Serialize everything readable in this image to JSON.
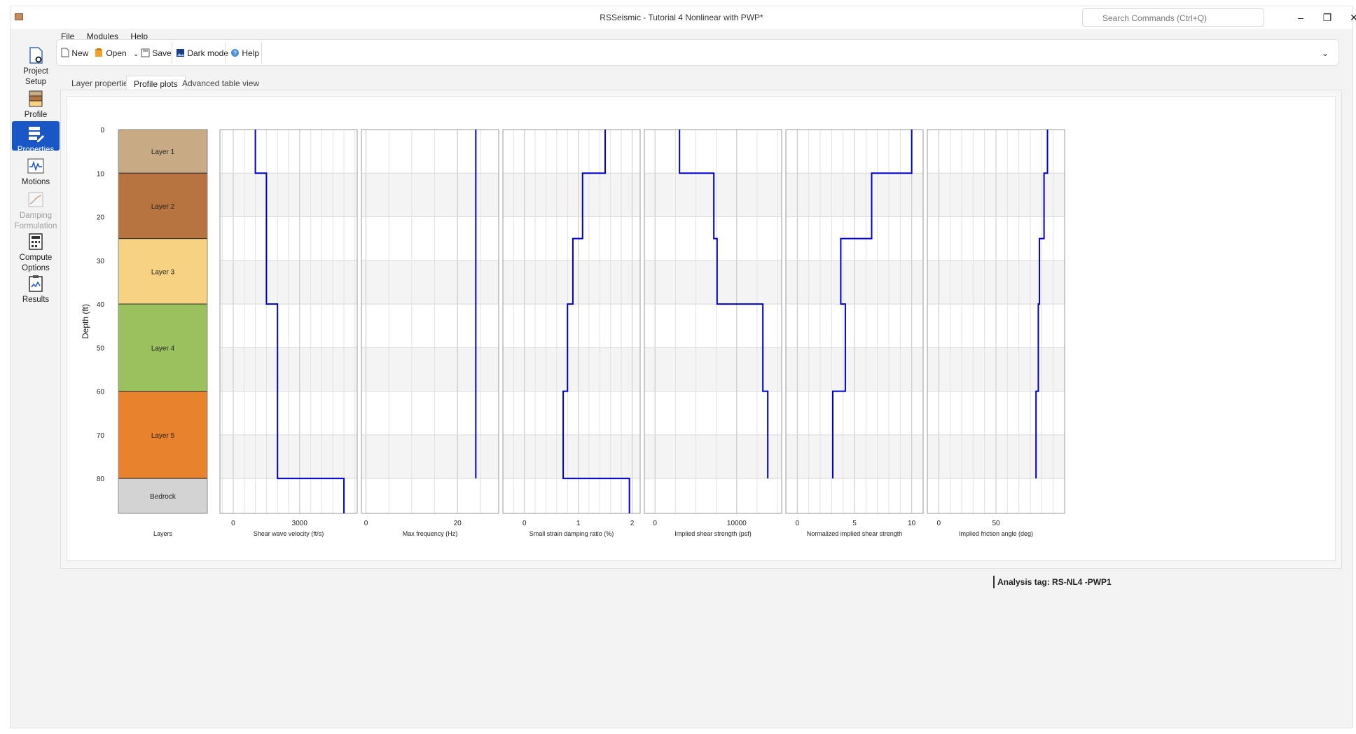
{
  "window": {
    "title": "RSSeismic - Tutorial 4 Nonlinear with PWP*",
    "search_placeholder": "Search Commands (Ctrl+Q)",
    "minimize": "–",
    "maximize": "❐",
    "close": "✕"
  },
  "menu": [
    "File",
    "Modules",
    "Help"
  ],
  "toolbar": {
    "new_label": "New",
    "open_label": "Open",
    "save_label": "Save",
    "dark_label": "Dark mode",
    "help_label": "Help"
  },
  "sidebar": {
    "items": [
      {
        "label_1": "Project",
        "label_2": "Setup"
      },
      {
        "label_1": "Profile",
        "label_2": ""
      },
      {
        "label_1": "Properties",
        "label_2": ""
      },
      {
        "label_1": "Motions",
        "label_2": ""
      },
      {
        "label_1": "Damping",
        "label_2": "Formulation"
      },
      {
        "label_1": "Compute",
        "label_2": "Options"
      },
      {
        "label_1": "Results",
        "label_2": ""
      }
    ]
  },
  "tabs": [
    "Layer properties",
    "Profile plots",
    "Advanced table view"
  ],
  "status": {
    "analysis_tag": "Analysis tag: RS-NL4 -PWP1"
  },
  "chart_data": {
    "type": "line",
    "ylabel": "Depth (ft)",
    "ylim": [
      0,
      88
    ],
    "yticks": [
      0,
      10,
      20,
      30,
      40,
      50,
      60,
      70,
      80
    ],
    "layers": {
      "xlabel": "Layers",
      "items": [
        {
          "name": "Layer 1",
          "top": 0,
          "bottom": 10,
          "color": "#c8aa84"
        },
        {
          "name": "Layer 2",
          "top": 10,
          "bottom": 25,
          "color": "#b87440"
        },
        {
          "name": "Layer 3",
          "top": 25,
          "bottom": 40,
          "color": "#f6d282"
        },
        {
          "name": "Layer 4",
          "top": 40,
          "bottom": 60,
          "color": "#9bc15e"
        },
        {
          "name": "Layer 5",
          "top": 60,
          "bottom": 80,
          "color": "#e9822d"
        },
        {
          "name": "Bedrock",
          "top": 80,
          "bottom": 88,
          "color": "#d3d3d3"
        }
      ]
    },
    "panels": [
      {
        "xlabel": "Shear wave velocity (ft/s)",
        "xlim": [
          -600,
          5600
        ],
        "xticks": [
          0,
          3000
        ],
        "minor": 500,
        "values": [
          1000,
          1500,
          2000,
          5000
        ]
      },
      {
        "xlabel": "Max frequency (Hz)",
        "xlim": [
          -1,
          29
        ],
        "xticks": [
          0,
          20
        ],
        "minor": 5,
        "values": [
          24,
          24,
          24,
          24
        ]
      },
      {
        "xlabel": "Small strain damping ratio (%)",
        "xlim": [
          -0.4,
          2.15
        ],
        "xticks": [
          0,
          1,
          2
        ],
        "minor": 0.2,
        "values": [
          1.5,
          1.08,
          0.9,
          0.8,
          0.72,
          1.95
        ]
      },
      {
        "xlabel": "Implied shear strength (psf)",
        "xlim": [
          -1300,
          15500
        ],
        "xticks": [
          0,
          10000
        ],
        "minor": 2500,
        "values": [
          3000,
          7200,
          7600,
          13200,
          13800
        ]
      },
      {
        "xlabel": "Normalized implied shear strength",
        "xlim": [
          -1,
          11
        ],
        "xticks": [
          0,
          5,
          10
        ],
        "minor": 1,
        "values": [
          10,
          6.5,
          3.8,
          4.2,
          3.1
        ]
      },
      {
        "xlabel": "Implied friction angle (deg)",
        "xlim": [
          -10,
          110
        ],
        "xticks": [
          0,
          50
        ],
        "minor": 10,
        "values": [
          95,
          92,
          88,
          87,
          85
        ]
      }
    ]
  }
}
